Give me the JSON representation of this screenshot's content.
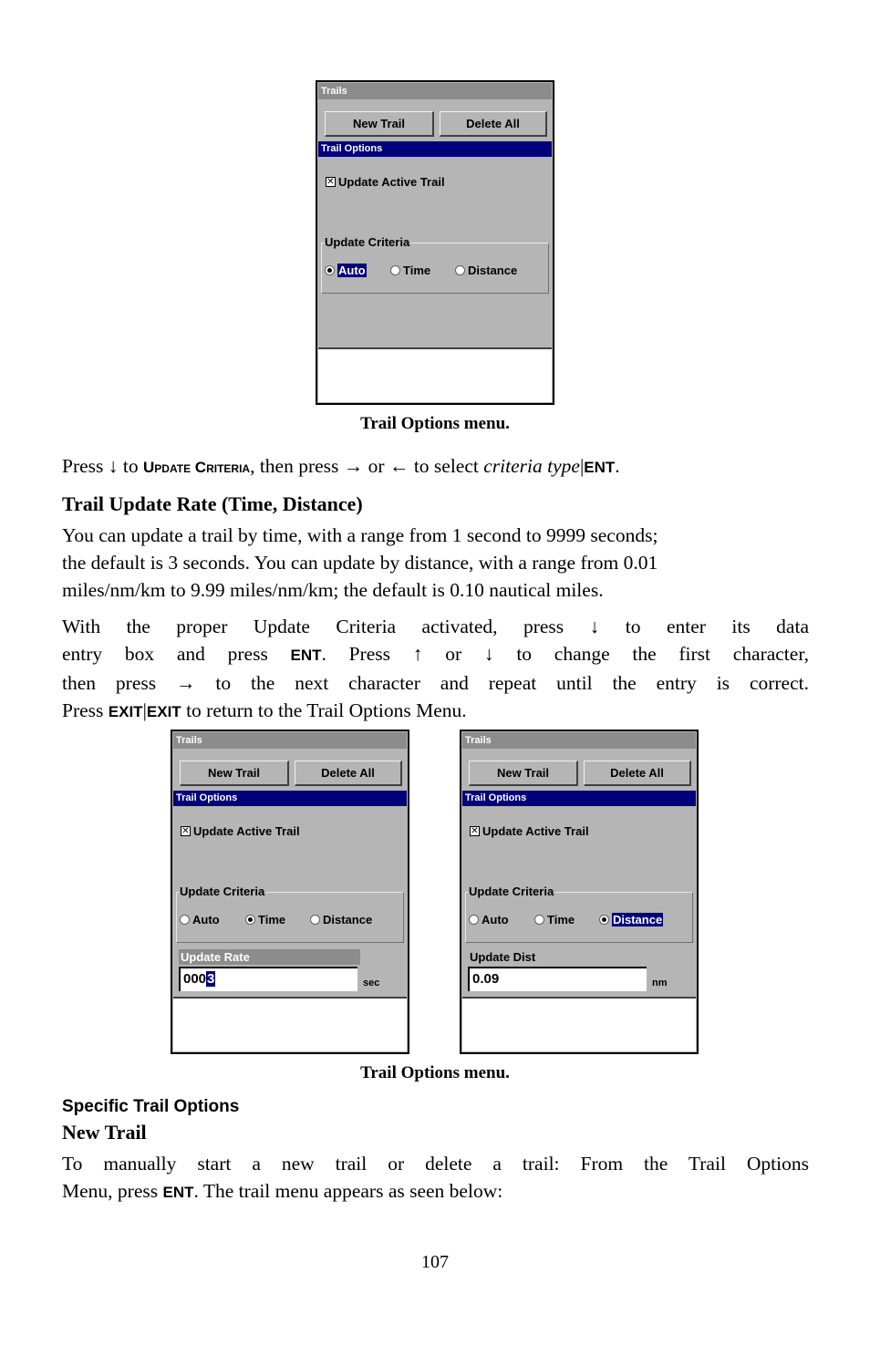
{
  "screens": {
    "top": {
      "title": "Trails",
      "new_trail": "New Trail",
      "delete_all": "Delete All",
      "section": "Trail Options",
      "checkbox_label": "Update Active Trail",
      "checkbox_mark": "✕",
      "group_label": "Update Criteria",
      "radios": [
        {
          "label": "Auto",
          "selected": true
        },
        {
          "label": "Time",
          "selected": false
        },
        {
          "label": "Distance",
          "selected": false
        }
      ]
    },
    "left": {
      "title": "Trails",
      "new_trail": "New Trail",
      "delete_all": "Delete All",
      "section": "Trail Options",
      "checkbox_label": "Update Active Trail",
      "checkbox_mark": "✕",
      "group_label": "Update Criteria",
      "radios": [
        {
          "label": "Auto",
          "selected": false
        },
        {
          "label": "Time",
          "selected": true
        },
        {
          "label": "Distance",
          "selected": false
        }
      ],
      "field_label": "Update Rate",
      "field_value_prefix": "000",
      "field_value_cursor": "3",
      "unit": "sec"
    },
    "right": {
      "title": "Trails",
      "new_trail": "New Trail",
      "delete_all": "Delete All",
      "section": "Trail Options",
      "checkbox_label": "Update Active Trail",
      "checkbox_mark": "✕",
      "group_label": "Update Criteria",
      "radios": [
        {
          "label": "Auto",
          "selected": false
        },
        {
          "label": "Time",
          "selected": false
        },
        {
          "label": "Distance",
          "selected": true
        }
      ],
      "field_label": "Update Dist",
      "field_value": "0.09",
      "unit": "nm"
    }
  },
  "captions": {
    "first": "Trail Options menu.",
    "second": "Trail Options menu."
  },
  "instruction1": {
    "press": "Press ",
    "down_arrow": "↓",
    "to": " to ",
    "update_criteria": "Update Criteria",
    "then_press": ", then press ",
    "right_arrow": "→",
    "or": " or ",
    "left_arrow": "←",
    "to_select": " to select ",
    "criteria_type": "criteria type",
    "sep": "|",
    "ent": "ENT",
    "period": "."
  },
  "section_rate": {
    "heading": "Trail Update Rate (Time, Distance)",
    "lines": [
      "You can update a trail by time, with a range from 1 second to 9999 seconds;",
      "the default is 3 seconds. You can update by distance, with a range from 0.01",
      "miles/nm/km to 9.99 miles/nm/km; the default is 0.10 nautical miles."
    ]
  },
  "instruction2": {
    "line1": "With the proper Update Criteria activated, press ↓ to enter its data",
    "line2_a": "entry box and press ",
    "line2_key": "ENT",
    "line2_b": ". Press ↑ or ↓ to change the first character,",
    "line3": "then press → to the next character and repeat until the entry is correct.",
    "line4_a": "Press ",
    "line4_key1": "EXIT",
    "line4_sep": "|",
    "line4_key2": "EXIT",
    "line4_b": " to return to the Trail Options Menu."
  },
  "specific": {
    "subhead": "Specific Trail Options",
    "heading": "New Trail",
    "line1": "To manually start a new trail or delete a trail: From the Trail Options",
    "line2_a": "Menu, press ",
    "line2_key": "ENT",
    "line2_b": ". The trail menu appears as seen below:"
  },
  "page_number": "107"
}
